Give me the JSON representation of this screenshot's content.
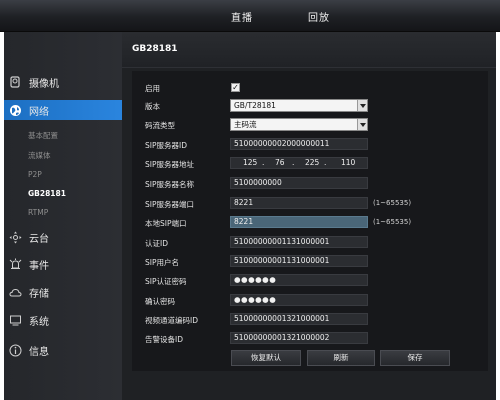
{
  "topbar": {
    "tabs": [
      {
        "label": "直播"
      },
      {
        "label": "回放"
      }
    ]
  },
  "sidebar": {
    "items": [
      {
        "label": "摄像机",
        "icon": "camera-icon"
      },
      {
        "label": "网络",
        "icon": "globe-icon",
        "active": true
      },
      {
        "label": "云台",
        "icon": "ptz-icon"
      },
      {
        "label": "事件",
        "icon": "alarm-icon"
      },
      {
        "label": "存储",
        "icon": "cloud-icon"
      },
      {
        "label": "系统",
        "icon": "monitor-icon"
      },
      {
        "label": "信息",
        "icon": "info-icon"
      }
    ],
    "network_sub": [
      {
        "label": "基本配置"
      },
      {
        "label": "流媒体"
      },
      {
        "label": "P2P"
      },
      {
        "label": "GB28181",
        "current": true
      },
      {
        "label": "RTMP"
      }
    ]
  },
  "content": {
    "title": "GB28181",
    "form": {
      "enable": {
        "label": "启用",
        "checked": true,
        "mark": "✓"
      },
      "version": {
        "label": "版本",
        "value": "GB/T28181"
      },
      "stream_type": {
        "label": "码流类型",
        "value": "主码流"
      },
      "sip_server_id": {
        "label": "SIP服务器ID",
        "value": "51000000002000000011"
      },
      "sip_server_addr": {
        "label": "SIP服务器地址",
        "octets": [
          "125",
          "76",
          "225",
          "110"
        ]
      },
      "sip_server_name": {
        "label": "SIP服务器名称",
        "value": "5100000000"
      },
      "sip_server_port": {
        "label": "SIP服务器端口",
        "value": "8221",
        "range": "(1~65535)"
      },
      "local_sip_port": {
        "label": "本地SIP端口",
        "value": "8221",
        "range": "(1~65535)"
      },
      "auth_id": {
        "label": "认证ID",
        "value": "51000000001131000001"
      },
      "sip_username": {
        "label": "SIP用户名",
        "value": "51000000001131000001"
      },
      "sip_auth_password": {
        "label": "SIP认证密码",
        "value": "●●●●●●"
      },
      "confirm_password": {
        "label": "确认密码",
        "value": "●●●●●●"
      },
      "video_channel_id": {
        "label": "视频通道编码ID",
        "value": "51000000001321000001"
      },
      "alarm_device_id": {
        "label": "告警设备ID",
        "value": "51000000001321000002"
      }
    },
    "buttons": {
      "restore": "恢复默认",
      "refresh": "刷新",
      "save": "保存"
    }
  },
  "colors": {
    "accent": "#2b86e0",
    "background": "#1f2124",
    "highlight_field": "#4a6678"
  }
}
